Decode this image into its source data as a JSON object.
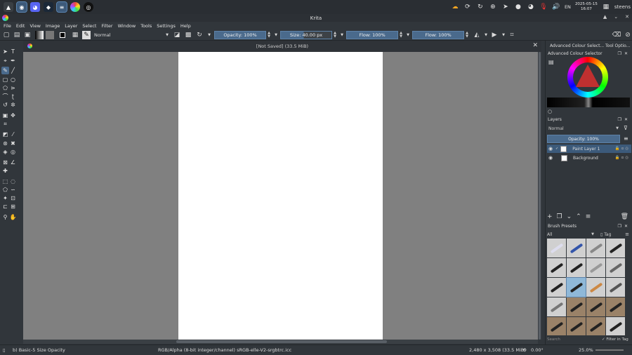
{
  "taskbar": {
    "apps": [
      "launcher-icon",
      "chromium-icon",
      "discord-icon",
      "steam-icon",
      "text-editor-icon",
      "krita-icon",
      "obs-icon"
    ],
    "tray": {
      "lang": "EN",
      "date": "2025-05-15",
      "time": "16:07",
      "user": "steens"
    }
  },
  "window": {
    "title": "Krita"
  },
  "menu": [
    "File",
    "Edit",
    "View",
    "Image",
    "Layer",
    "Select",
    "Filter",
    "Window",
    "Tools",
    "Settings",
    "Help"
  ],
  "toolbar": {
    "blend_mode": "Normal",
    "opacity": "Opacity: 100%",
    "size": "Size: 40.00 px",
    "flow1": "Flow: 100%",
    "flow2": "Flow: 100%"
  },
  "document": {
    "tab_title": "[Not Saved]  (33.5 MiB)"
  },
  "docker": {
    "tabs": [
      "Advanced Colour Select...",
      "Tool Optio..."
    ],
    "color_panel_title": "Advanced Colour Selector",
    "layers_title": "Layers",
    "layers_blend": "Normal",
    "layers_opacity": "Opacity: 100%",
    "layers": [
      {
        "name": "Paint Layer 1",
        "selected": true
      },
      {
        "name": "Background",
        "selected": false
      }
    ],
    "brush_title": "Brush Presets",
    "brush_filter": "All",
    "brush_tag": "Tag",
    "brush_search": "Search",
    "filter_in_tag": "Filter in Tag"
  },
  "status": {
    "brush": "b) Basic-5 Size Opacity",
    "color_profile": "RGB/Alpha (8-bit integer/channel)  sRGB-elle-V2-srgbtrc.icc",
    "dimensions": "2,480 x 3,508 (33.5 MiB)",
    "rotation": "0.00°",
    "zoom": "25.0%"
  },
  "colors": {
    "accent": "#4a6a8c",
    "bg": "#31363b",
    "canvas_bg": "#808080"
  }
}
